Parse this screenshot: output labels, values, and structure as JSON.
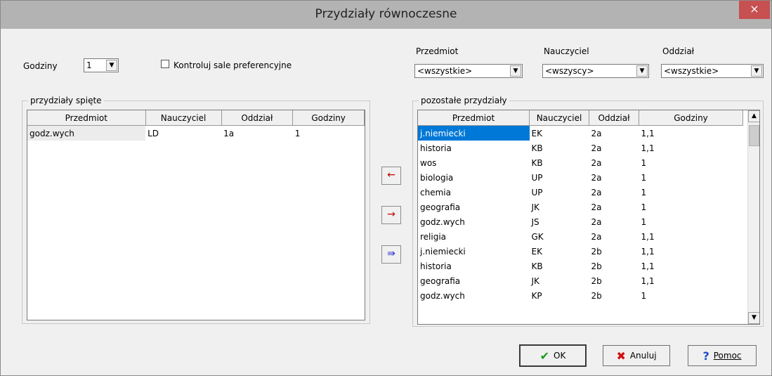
{
  "window": {
    "title": "Przydziały równoczesne",
    "close_label": "×"
  },
  "top": {
    "hours_label": "Godziny",
    "hours_value": "1",
    "check_label": "Kontroluj sale preferencyjne",
    "check_checked": false
  },
  "filters": {
    "subject_label": "Przedmiot",
    "subject_value": "<wszystkie>",
    "teacher_label": "Nauczyciel",
    "teacher_value": "<wszyscy>",
    "class_label": "Oddział",
    "class_value": "<wszystkie>"
  },
  "linked": {
    "title": "przydziały spięte",
    "columns": [
      "Przedmiot",
      "Nauczyciel",
      "Oddział",
      "Godziny"
    ],
    "rows": [
      [
        "godz.wych",
        "LD",
        "1a",
        "1"
      ]
    ]
  },
  "remaining": {
    "title": "pozostałe przydziały",
    "columns": [
      "Przedmiot",
      "Nauczyciel",
      "Oddział",
      "Godziny"
    ],
    "rows": [
      [
        "j.niemiecki",
        "EK",
        "2a",
        "1,1"
      ],
      [
        "historia",
        "KB",
        "2a",
        "1,1"
      ],
      [
        "wos",
        "KB",
        "2a",
        "1"
      ],
      [
        "biologia",
        "UP",
        "2a",
        "1"
      ],
      [
        "chemia",
        "UP",
        "2a",
        "1"
      ],
      [
        "geografia",
        "JK",
        "2a",
        "1"
      ],
      [
        "godz.wych",
        "JS",
        "2a",
        "1"
      ],
      [
        "religia",
        "GK",
        "2a",
        "1,1"
      ],
      [
        "j.niemiecki",
        "EK",
        "2b",
        "1,1"
      ],
      [
        "historia",
        "KB",
        "2b",
        "1,1"
      ],
      [
        "geografia",
        "JK",
        "2b",
        "1,1"
      ],
      [
        "godz.wych",
        "KP",
        "2b",
        "1"
      ]
    ]
  },
  "arrows": {
    "left": "←",
    "right": "→",
    "all_right": "⇛"
  },
  "buttons": {
    "ok": "OK",
    "cancel": "Anuluj",
    "help": "Pomoc"
  },
  "colors": {
    "selection": "#0078d7",
    "close": "#c75050",
    "titlebar": "#b3b3b3"
  }
}
